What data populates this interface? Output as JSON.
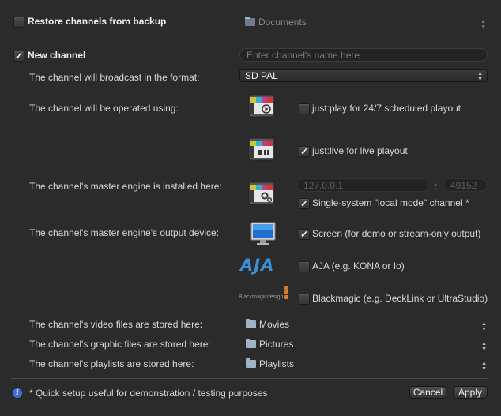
{
  "restore": {
    "label": "Restore channels from backup",
    "checked": false,
    "folder": "Documents"
  },
  "new_channel": {
    "label": "New channel",
    "checked": true,
    "name_placeholder": "Enter channel's name here"
  },
  "format": {
    "label": "The channel will broadcast in the format:",
    "value": "SD PAL"
  },
  "operated": {
    "label": "The channel will be operated using:",
    "justplay": {
      "label": "just:play for 24/7 scheduled playout",
      "checked": false
    },
    "justlive": {
      "label": "just:live for live playout",
      "checked": true
    }
  },
  "engine": {
    "label": "The channel's master engine is installed here:",
    "ip_placeholder": "127.0.0.1",
    "colon": ":",
    "port_placeholder": "49152",
    "local_mode": {
      "label": "Single-system \"local mode\" channel *",
      "checked": true
    }
  },
  "output": {
    "label": "The channel's master engine's output device:",
    "screen": {
      "label": "Screen (for demo or stream-only output)",
      "checked": true
    },
    "aja": {
      "label": "AJA (e.g. KONA or Io)",
      "checked": false,
      "logo_text": "AJA"
    },
    "blackmagic": {
      "label": "Blackmagic (e.g. DeckLink or UltraStudio)",
      "checked": false,
      "logo_text": "Blackmagicdesign"
    }
  },
  "storage": {
    "video": {
      "label": "The channel's video files are stored here:",
      "folder": "Movies"
    },
    "graphic": {
      "label": "The channel's graphic files are stored here:",
      "folder": "Pictures"
    },
    "playlists": {
      "label": "The channel's playlists are stored here:",
      "folder": "Playlists"
    }
  },
  "footer": {
    "note": "* Quick setup useful for demonstration / testing purposes",
    "info_icon": "i",
    "cancel": "Cancel",
    "apply": "Apply"
  },
  "checkmark": "✓",
  "colors": {
    "background": "#2b2b2b",
    "accent": "#3b6fd6"
  }
}
